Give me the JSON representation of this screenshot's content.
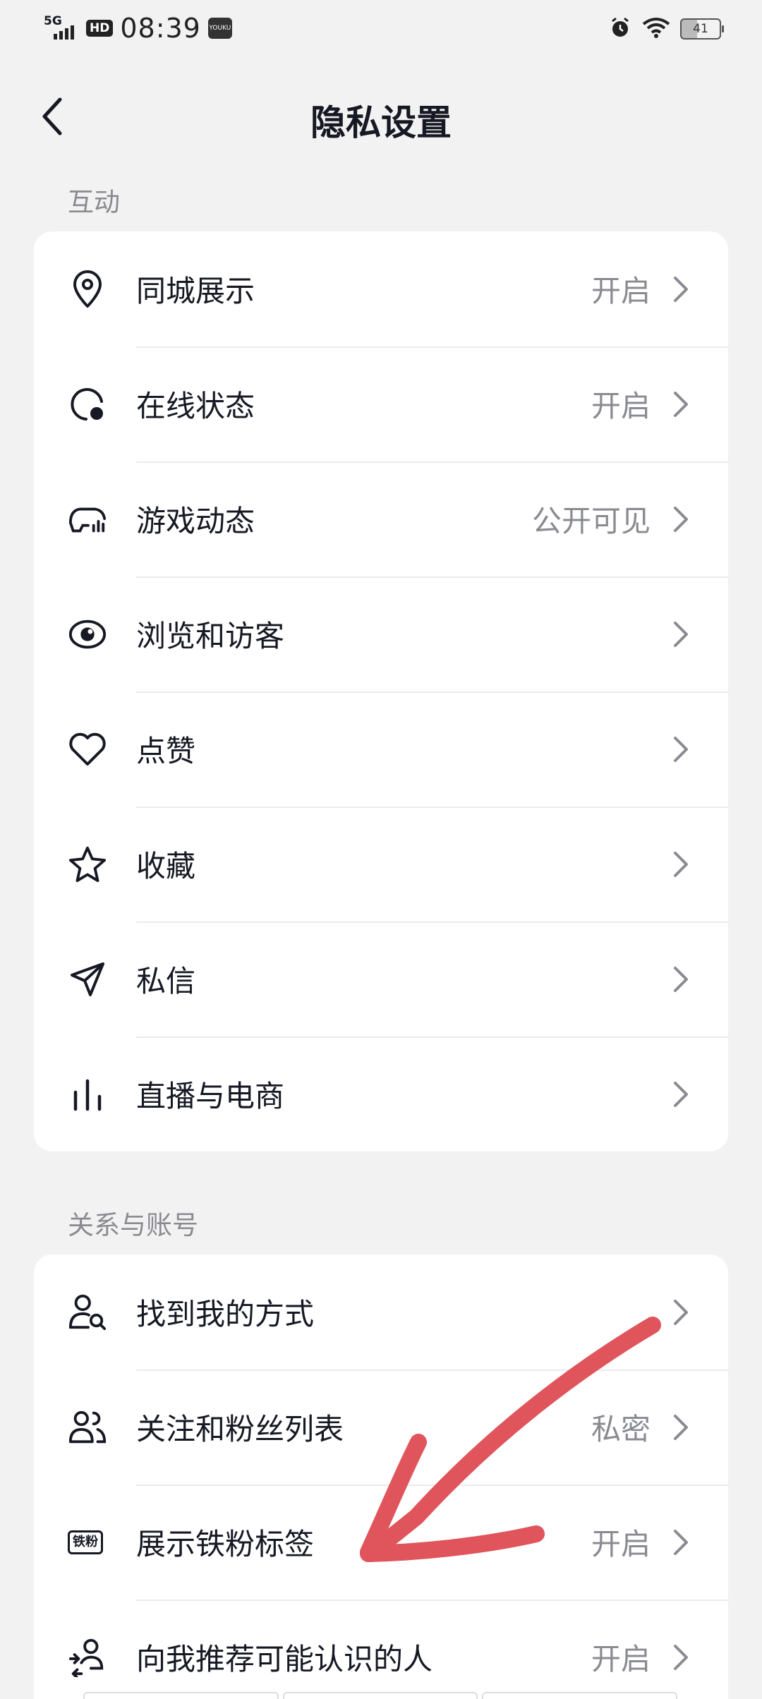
{
  "status_bar": {
    "network": "5G",
    "hd": "HD",
    "time": "08:39",
    "app_badge": "YOUKU",
    "battery": "41",
    "icons": [
      "signal-icon",
      "alarm-icon",
      "wifi-icon",
      "battery-icon"
    ]
  },
  "header": {
    "title": "隐私设置",
    "back_icon": "chevron-left-icon"
  },
  "sections": [
    {
      "label": "互动",
      "items": [
        {
          "icon": "location-pin-icon",
          "label": "同城展示",
          "value": "开启"
        },
        {
          "icon": "online-status-icon",
          "label": "在线状态",
          "value": "开启"
        },
        {
          "icon": "game-controller-icon",
          "label": "游戏动态",
          "value": "公开可见"
        },
        {
          "icon": "eye-icon",
          "label": "浏览和访客",
          "value": ""
        },
        {
          "icon": "heart-icon",
          "label": "点赞",
          "value": ""
        },
        {
          "icon": "star-icon",
          "label": "收藏",
          "value": ""
        },
        {
          "icon": "paper-plane-icon",
          "label": "私信",
          "value": ""
        },
        {
          "icon": "live-bars-icon",
          "label": "直播与电商",
          "value": ""
        }
      ]
    },
    {
      "label": "关系与账号",
      "items": [
        {
          "icon": "user-search-icon",
          "label": "找到我的方式",
          "value": ""
        },
        {
          "icon": "users-icon",
          "label": "关注和粉丝列表",
          "value": "私密"
        },
        {
          "icon": "iron-fan-badge-icon",
          "label": "展示铁粉标签",
          "value": "开启",
          "badge_text": "铁粉"
        },
        {
          "icon": "recommend-user-icon",
          "label": "向我推荐可能认识的人",
          "value": "开启"
        }
      ]
    }
  ],
  "colors": {
    "background": "#f2f2f2",
    "card": "#ffffff",
    "text_primary": "#161823",
    "text_secondary": "#8a8b91",
    "annotation_arrow": "#e0545c"
  }
}
